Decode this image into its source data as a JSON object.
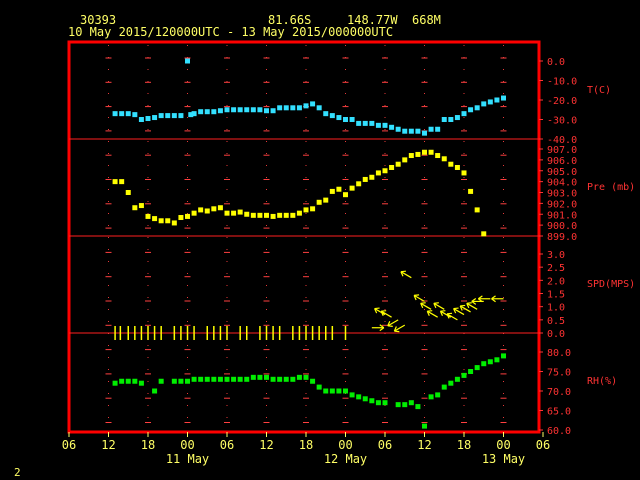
{
  "header": {
    "station_id": "30393",
    "latitude": "81.66S",
    "longitude": "148.77W",
    "elevation": "668M",
    "time_range": "10 May 2015/120000UTC - 13 May 2015/000000UTC"
  },
  "page_number": "2",
  "colors": {
    "frame": "#ff0000",
    "divider": "#ff2020",
    "axis_text": "#ff3333",
    "header_text": "#ffff66",
    "grid_marker": "#ff4040",
    "temperature": "#33e0ff",
    "pressure": "#ffff00",
    "wind": "#ffff00",
    "humidity": "#00ee00"
  },
  "x_axis": {
    "hour_labels": [
      "06",
      "12",
      "18",
      "00",
      "06",
      "12",
      "18",
      "00",
      "06",
      "12",
      "18",
      "00",
      "06"
    ],
    "day_labels": [
      {
        "label": "11 May",
        "hour": 24
      },
      {
        "label": "12 May",
        "hour": 48
      },
      {
        "label": "13 May",
        "hour": 72
      }
    ]
  },
  "chart_data": [
    {
      "type": "scatter",
      "label": "T(C)",
      "ylim": [
        -40,
        0
      ],
      "ticks": [
        "0.0",
        "-10.0",
        "-20.0",
        "-30.0",
        "-40.0"
      ],
      "x_unit": "hours after 10 May 2015 00UTC",
      "points": [
        [
          13,
          -27
        ],
        [
          14,
          -27
        ],
        [
          15,
          -27
        ],
        [
          16,
          -27.5
        ],
        [
          17,
          -30
        ],
        [
          18,
          -29.5
        ],
        [
          19,
          -29
        ],
        [
          20,
          -28
        ],
        [
          21,
          -28
        ],
        [
          22,
          -28
        ],
        [
          23,
          -28
        ],
        [
          24,
          0
        ],
        [
          24.5,
          -27.5
        ],
        [
          25,
          -27
        ],
        [
          26,
          -26
        ],
        [
          27,
          -26
        ],
        [
          28,
          -26
        ],
        [
          29,
          -25.5
        ],
        [
          30,
          -25
        ],
        [
          31,
          -25
        ],
        [
          32,
          -25
        ],
        [
          33,
          -25
        ],
        [
          34,
          -25
        ],
        [
          35,
          -25
        ],
        [
          36,
          -25.5
        ],
        [
          37,
          -25.5
        ],
        [
          38,
          -24
        ],
        [
          39,
          -24
        ],
        [
          40,
          -24
        ],
        [
          41,
          -24
        ],
        [
          42,
          -23
        ],
        [
          43,
          -22
        ],
        [
          44,
          -24
        ],
        [
          45,
          -27
        ],
        [
          46,
          -28
        ],
        [
          47,
          -29
        ],
        [
          48,
          -30
        ],
        [
          49,
          -30
        ],
        [
          50,
          -32
        ],
        [
          51,
          -32
        ],
        [
          52,
          -32
        ],
        [
          53,
          -33
        ],
        [
          54,
          -33
        ],
        [
          55,
          -34
        ],
        [
          56,
          -35
        ],
        [
          57,
          -36
        ],
        [
          58,
          -36
        ],
        [
          59,
          -36
        ],
        [
          60,
          -37
        ],
        [
          61,
          -35
        ],
        [
          62,
          -35
        ],
        [
          63,
          -30
        ],
        [
          64,
          -30
        ],
        [
          65,
          -29
        ],
        [
          66,
          -27
        ],
        [
          67,
          -25
        ],
        [
          68,
          -24
        ],
        [
          69,
          -22
        ],
        [
          70,
          -21
        ],
        [
          71,
          -20
        ],
        [
          72,
          -19
        ]
      ]
    },
    {
      "type": "scatter",
      "label": "Pre (mb)",
      "ylim": [
        899,
        907
      ],
      "ticks": [
        "907.0",
        "906.0",
        "905.0",
        "904.0",
        "903.0",
        "902.0",
        "901.0",
        "900.0",
        "899.0"
      ],
      "points": [
        [
          13,
          904.0
        ],
        [
          14,
          904.0
        ],
        [
          15,
          903.0
        ],
        [
          16,
          901.6
        ],
        [
          17,
          901.8
        ],
        [
          18,
          900.8
        ],
        [
          19,
          900.6
        ],
        [
          20,
          900.4
        ],
        [
          21,
          900.4
        ],
        [
          22,
          900.2
        ],
        [
          23,
          900.7
        ],
        [
          24,
          900.8
        ],
        [
          25,
          901.1
        ],
        [
          26,
          901.4
        ],
        [
          27,
          901.3
        ],
        [
          28,
          901.5
        ],
        [
          29,
          901.6
        ],
        [
          30,
          901.1
        ],
        [
          31,
          901.1
        ],
        [
          32,
          901.2
        ],
        [
          33,
          901.0
        ],
        [
          34,
          900.9
        ],
        [
          35,
          900.9
        ],
        [
          36,
          900.9
        ],
        [
          37,
          900.8
        ],
        [
          38,
          900.9
        ],
        [
          39,
          900.9
        ],
        [
          40,
          900.9
        ],
        [
          41,
          901.1
        ],
        [
          42,
          901.4
        ],
        [
          43,
          901.5
        ],
        [
          44,
          902.1
        ],
        [
          45,
          902.3
        ],
        [
          46,
          903.1
        ],
        [
          47,
          903.3
        ],
        [
          48,
          902.8
        ],
        [
          49,
          903.4
        ],
        [
          50,
          903.8
        ],
        [
          51,
          904.2
        ],
        [
          52,
          904.4
        ],
        [
          53,
          904.8
        ],
        [
          54,
          905.0
        ],
        [
          55,
          905.3
        ],
        [
          56,
          905.6
        ],
        [
          57,
          906.0
        ],
        [
          58,
          906.4
        ],
        [
          59,
          906.5
        ],
        [
          60,
          906.7
        ],
        [
          61,
          906.7
        ],
        [
          62,
          906.4
        ],
        [
          63,
          906.1
        ],
        [
          64,
          905.6
        ],
        [
          65,
          905.3
        ],
        [
          66,
          904.8
        ],
        [
          67,
          903.1
        ],
        [
          68,
          901.4
        ],
        [
          69,
          899.2
        ]
      ]
    },
    {
      "type": "wind_barb",
      "label": "SPD(MPS)",
      "ylim": [
        0,
        3
      ],
      "ticks": [
        "3.0",
        "2.5",
        "2.0",
        "1.5",
        "1.0",
        "0.5",
        "0.0"
      ],
      "points": [
        [
          13,
          0,
          "N"
        ],
        [
          13.8,
          0,
          "N"
        ],
        [
          15,
          0,
          "N"
        ],
        [
          16,
          0,
          "N"
        ],
        [
          17,
          0,
          "N"
        ],
        [
          18,
          0,
          "N"
        ],
        [
          19,
          0,
          "N"
        ],
        [
          20,
          0,
          "N"
        ],
        [
          22,
          0,
          "N"
        ],
        [
          23,
          0,
          "N"
        ],
        [
          24,
          0,
          "N"
        ],
        [
          25,
          0,
          "N"
        ],
        [
          27,
          0,
          "N"
        ],
        [
          28,
          0,
          "N"
        ],
        [
          29,
          0,
          "N"
        ],
        [
          30,
          0,
          "N"
        ],
        [
          32,
          0,
          "N"
        ],
        [
          33,
          0,
          "N"
        ],
        [
          35,
          0,
          "N"
        ],
        [
          36,
          0,
          "N"
        ],
        [
          37,
          0,
          "N"
        ],
        [
          38,
          0,
          "N"
        ],
        [
          40,
          0,
          "N"
        ],
        [
          41,
          0,
          "N"
        ],
        [
          42,
          0,
          "N"
        ],
        [
          43,
          0,
          "N"
        ],
        [
          44,
          0,
          "N"
        ],
        [
          45,
          0,
          "N"
        ],
        [
          46,
          0,
          "N"
        ],
        [
          48,
          0,
          "N"
        ],
        [
          52,
          0.2,
          "W"
        ],
        [
          54,
          0.7,
          "SW"
        ],
        [
          55,
          0.6,
          "SW"
        ],
        [
          56,
          0.5,
          "NW"
        ],
        [
          57,
          0.3,
          "NW"
        ],
        [
          58,
          2.1,
          "SW"
        ],
        [
          60,
          1.2,
          "SW"
        ],
        [
          61,
          0.9,
          "SW"
        ],
        [
          62,
          0.6,
          "SW"
        ],
        [
          63,
          0.9,
          "SW"
        ],
        [
          64,
          0.6,
          "SW"
        ],
        [
          65,
          0.5,
          "SW"
        ],
        [
          66,
          0.7,
          "SW"
        ],
        [
          67,
          0.8,
          "SW"
        ],
        [
          68,
          0.9,
          "SW"
        ],
        [
          69,
          1.2,
          "E"
        ],
        [
          70,
          1.3,
          "E"
        ],
        [
          72,
          1.3,
          "E"
        ]
      ]
    },
    {
      "type": "scatter",
      "label": "RH(%)",
      "ylim": [
        60,
        80
      ],
      "ticks": [
        "80.0",
        "75.0",
        "70.0",
        "65.0",
        "60.0"
      ],
      "points": [
        [
          13,
          72
        ],
        [
          14,
          72.5
        ],
        [
          15,
          72.5
        ],
        [
          16,
          72.5
        ],
        [
          17,
          72
        ],
        [
          19,
          70
        ],
        [
          20,
          72.5
        ],
        [
          22,
          72.5
        ],
        [
          23,
          72.5
        ],
        [
          24,
          72.5
        ],
        [
          25,
          73
        ],
        [
          26,
          73
        ],
        [
          27,
          73
        ],
        [
          28,
          73
        ],
        [
          29,
          73
        ],
        [
          30,
          73
        ],
        [
          31,
          73
        ],
        [
          32,
          73
        ],
        [
          33,
          73
        ],
        [
          34,
          73.5
        ],
        [
          35,
          73.5
        ],
        [
          36,
          73.5
        ],
        [
          37,
          73
        ],
        [
          38,
          73
        ],
        [
          39,
          73
        ],
        [
          40,
          73
        ],
        [
          41,
          73.5
        ],
        [
          42,
          73.5
        ],
        [
          43,
          72.5
        ],
        [
          44,
          71
        ],
        [
          45,
          70
        ],
        [
          46,
          70
        ],
        [
          47,
          70
        ],
        [
          48,
          70
        ],
        [
          49,
          69
        ],
        [
          50,
          68.5
        ],
        [
          51,
          68
        ],
        [
          52,
          67.5
        ],
        [
          53,
          67
        ],
        [
          54,
          67
        ],
        [
          56,
          66.5
        ],
        [
          57,
          66.5
        ],
        [
          58,
          67
        ],
        [
          59,
          66
        ],
        [
          60,
          61
        ],
        [
          61,
          68.5
        ],
        [
          62,
          69
        ],
        [
          63,
          71
        ],
        [
          64,
          72
        ],
        [
          65,
          73
        ],
        [
          66,
          74
        ],
        [
          67,
          75
        ],
        [
          68,
          76
        ],
        [
          69,
          77
        ],
        [
          70,
          77.5
        ],
        [
          71,
          78
        ],
        [
          72,
          79
        ]
      ]
    }
  ]
}
